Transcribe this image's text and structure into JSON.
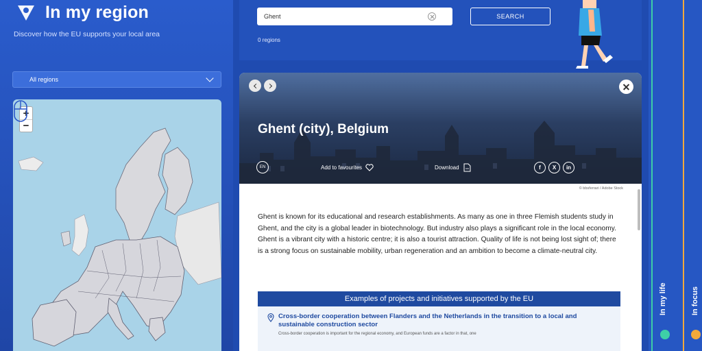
{
  "brand": {
    "title": "In my region",
    "subtitle": "Discover how the EU supports your local area"
  },
  "region_select": {
    "selected": "All regions"
  },
  "map": {
    "zoom_in": "+",
    "zoom_out": "−"
  },
  "search": {
    "value": "Ghent",
    "button": "SEARCH",
    "result_count": "0 regions"
  },
  "card": {
    "title": "Ghent (city), Belgium",
    "lang": "EN",
    "favourites": "Add to favourites",
    "download": "Download",
    "credit": "© bbsferrari / Adobe Stock",
    "description": "Ghent is known for its educational and research establishments. As many as one in three Flemish students study in Ghent, and the city is a global leader in biotechnology. But industry also plays a significant role in the local economy. Ghent is a vibrant city with a historic centre; it is also a tourist attraction. Quality of life is not being lost sight of; there is a strong focus on sustainable mobility, urban regeneration and an ambition to become a climate-neutral city.",
    "projects_header": "Examples of projects and initiatives supported by the EU",
    "project": {
      "title": "Cross-border cooperation between Flanders and the Netherlands in the transition to a local and sustainable construction sector",
      "desc": "Cross-border cooperation is important for the regional economy, and European funds are a factor in that, one"
    },
    "shares": [
      "f",
      "X",
      "in"
    ]
  },
  "tabs": {
    "life": "In my life",
    "focus": "In focus"
  },
  "colors": {
    "primary": "#2352bb",
    "accent_green": "#3ecfa7",
    "accent_orange": "#f3a93a"
  }
}
